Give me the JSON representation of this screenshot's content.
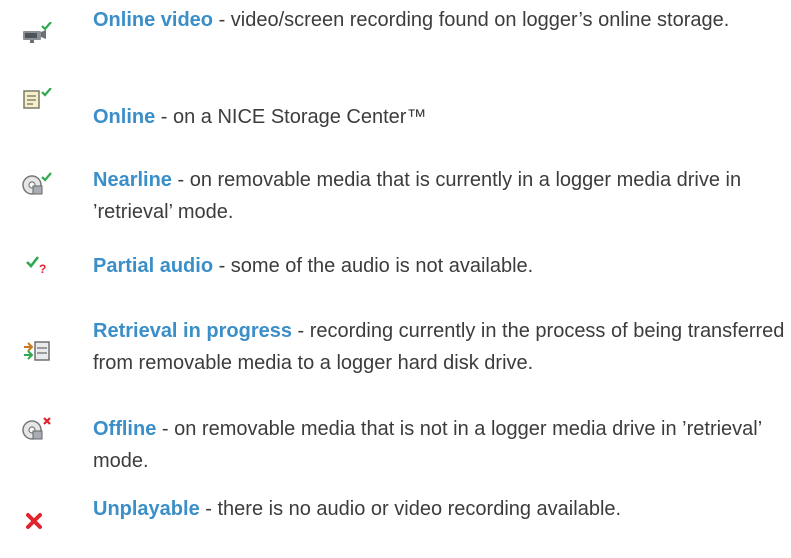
{
  "colors": {
    "term": "#3b8fc9",
    "text": "#3c3c3c",
    "check": "#2fa84f",
    "error": "#e0242c"
  },
  "items": [
    {
      "icon": "online-video-icon",
      "term": "Online video",
      "desc": " - video/screen recording found on logger’s online storage."
    },
    {
      "icon": "online-storage-icon",
      "term": "Online",
      "desc": " - on a NICE Storage Center™"
    },
    {
      "icon": "nearline-disc-icon",
      "term": "Nearline",
      "desc": " - on removable media that is currently in a logger media drive in ’retrieval’ mode."
    },
    {
      "icon": "partial-audio-icon",
      "term": "Partial audio",
      "desc": " - some of the audio is not available."
    },
    {
      "icon": "retrieval-in-progress-icon",
      "term": "Retrieval in progress",
      "desc": " - recording currently in the process of being transferred from removable media to a logger hard disk drive."
    },
    {
      "icon": "offline-disc-icon",
      "term": "Offline",
      "desc": " - on removable media that is not in a logger media drive in ’retrieval’ mode."
    },
    {
      "icon": "unplayable-icon",
      "term": "Unplayable",
      "desc": " - there is no audio or video recording available."
    }
  ]
}
